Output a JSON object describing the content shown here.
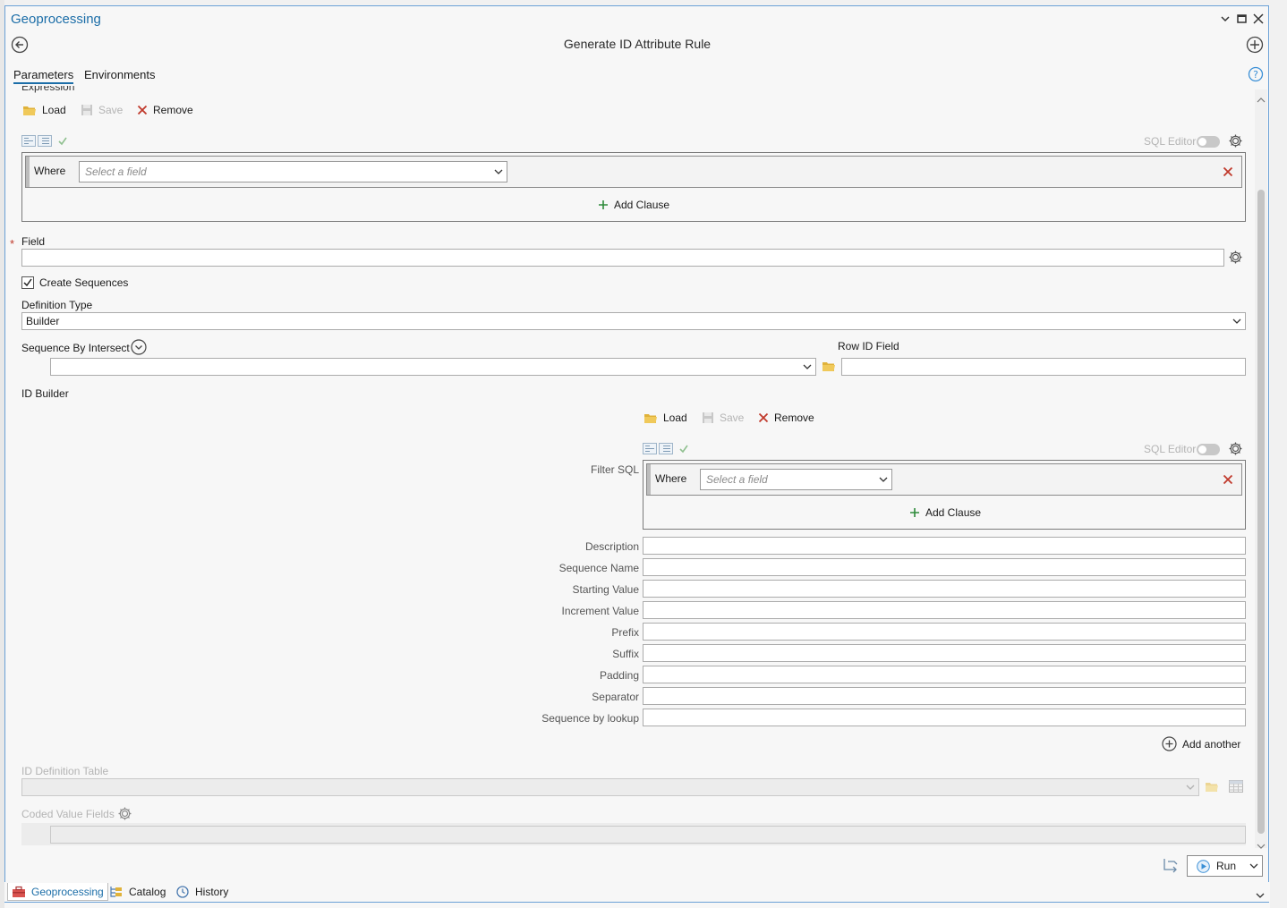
{
  "panel": {
    "title": "Geoprocessing",
    "tool_title": "Generate ID Attribute Rule"
  },
  "tabs": {
    "parameters": "Parameters",
    "environments": "Environments"
  },
  "expression": {
    "section_label": "Expression",
    "load": "Load",
    "save": "Save",
    "remove": "Remove",
    "sql_editor": "SQL Editor",
    "where": "Where",
    "select_placeholder": "Select a field",
    "add_clause": "Add Clause"
  },
  "field": {
    "label": "Field",
    "value": ""
  },
  "create_sequences": {
    "label": "Create Sequences",
    "checked": true
  },
  "definition_type": {
    "label": "Definition Type",
    "value": "Builder"
  },
  "sequence_by_intersect": {
    "label": "Sequence By Intersect",
    "value": ""
  },
  "row_id_field": {
    "label": "Row ID Field",
    "value": ""
  },
  "id_builder": {
    "label": "ID Builder",
    "load": "Load",
    "save": "Save",
    "remove": "Remove",
    "sql_editor": "SQL Editor",
    "filter_sql": "Filter SQL",
    "where": "Where",
    "select_placeholder": "Select a field",
    "add_clause": "Add Clause",
    "fields": [
      {
        "label": "Description",
        "value": ""
      },
      {
        "label": "Sequence Name",
        "value": ""
      },
      {
        "label": "Starting Value",
        "value": ""
      },
      {
        "label": "Increment Value",
        "value": ""
      },
      {
        "label": "Prefix",
        "value": ""
      },
      {
        "label": "Suffix",
        "value": ""
      },
      {
        "label": "Padding",
        "value": ""
      },
      {
        "label": "Separator",
        "value": ""
      },
      {
        "label": "Sequence by lookup",
        "value": ""
      }
    ],
    "add_another": "Add another"
  },
  "id_definition_table": {
    "label": "ID Definition Table",
    "value": ""
  },
  "coded_value_fields": {
    "label": "Coded Value Fields"
  },
  "run": {
    "label": "Run"
  },
  "bottom_tabs": [
    "Geoprocessing",
    "Catalog",
    "History"
  ],
  "colors": {
    "accent": "#1c6ea8",
    "remove": "#c0392b",
    "add": "#2e8b3a",
    "folder": "#e0b23a"
  }
}
